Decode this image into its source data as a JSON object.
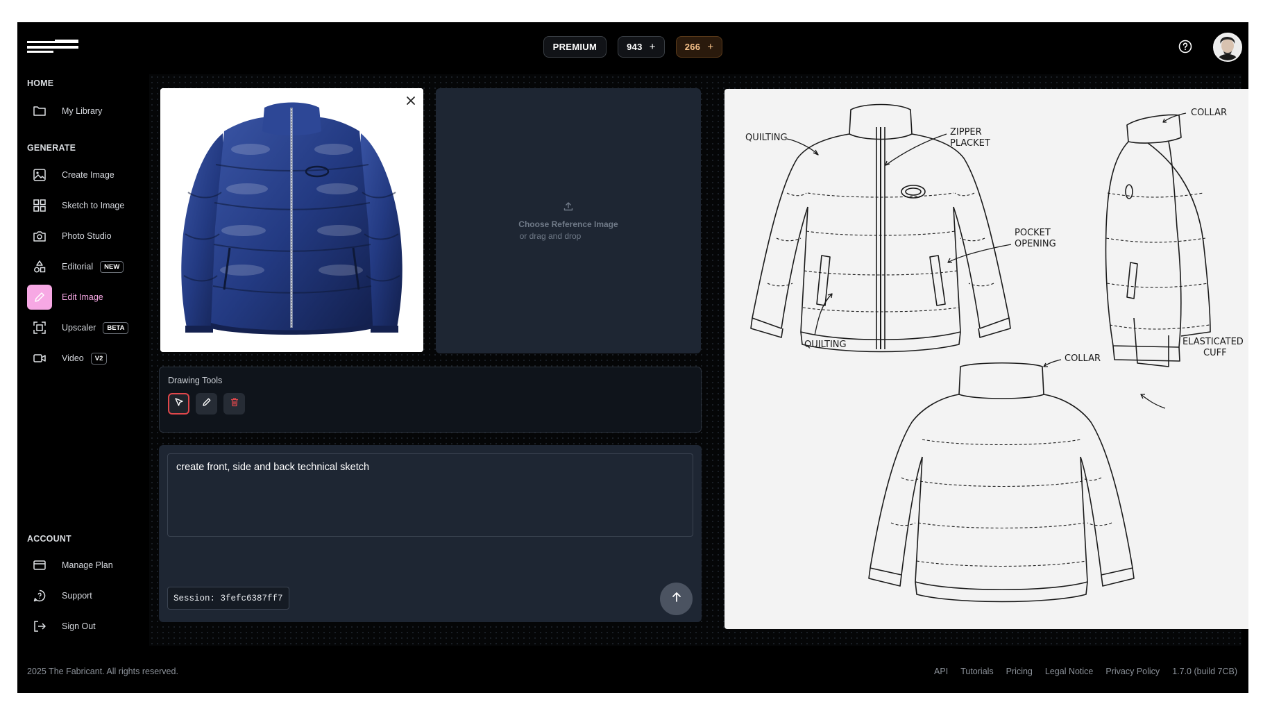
{
  "header": {
    "plan_label": "PREMIUM",
    "credits_a": "943",
    "credits_b": "266",
    "plus_glyph": "+"
  },
  "sidebar": {
    "home": "HOME",
    "library": "My Library",
    "generate": "GENERATE",
    "items": [
      {
        "label": "Create Image",
        "icon": "image-icon"
      },
      {
        "label": "Sketch to Image",
        "icon": "grid-icon"
      },
      {
        "label": "Photo Studio",
        "icon": "camera-icon"
      },
      {
        "label": "Editorial",
        "icon": "shapes-icon",
        "badge": "NEW"
      },
      {
        "label": "Edit Image",
        "icon": "pencil-icon",
        "active": true
      },
      {
        "label": "Upscaler",
        "icon": "expand-icon",
        "badge": "BETA"
      },
      {
        "label": "Video",
        "icon": "video-icon",
        "badge": "V2"
      }
    ],
    "account": "ACCOUNT",
    "account_items": [
      {
        "label": "Manage Plan",
        "icon": "card-icon"
      },
      {
        "label": "Support",
        "icon": "chat-icon"
      },
      {
        "label": "Sign Out",
        "icon": "signout-icon"
      }
    ]
  },
  "reference": {
    "title": "Choose Reference Image",
    "subtitle": "or drag and drop"
  },
  "tools": {
    "title": "Drawing Tools"
  },
  "prompt": {
    "value": "create front, side and back technical sketch",
    "session": "Session: 3fefc6387ff7"
  },
  "sketch_labels": {
    "quilting_1": "QUILTING",
    "zipper_1": "ZIPPER",
    "zipper_2": "PLACKET",
    "collar_side": "COLLAR",
    "pocket_1": "POCKET",
    "pocket_2": "OPENING",
    "quilting_2": "QUILTING",
    "collar_back": "COLLAR",
    "cuff_1": "ELASTICATED",
    "cuff_2": "CUFF"
  },
  "footer": {
    "copyright": "2025 The Fabricant. All rights reserved.",
    "links": [
      "API",
      "Tutorials",
      "Pricing",
      "Legal Notice",
      "Privacy Policy",
      "1.7.0 (build 7CB)"
    ]
  },
  "colors": {
    "accent_pink": "#f7a8e4",
    "panel": "#1e2633",
    "jacket_blue": "#243a7a"
  }
}
